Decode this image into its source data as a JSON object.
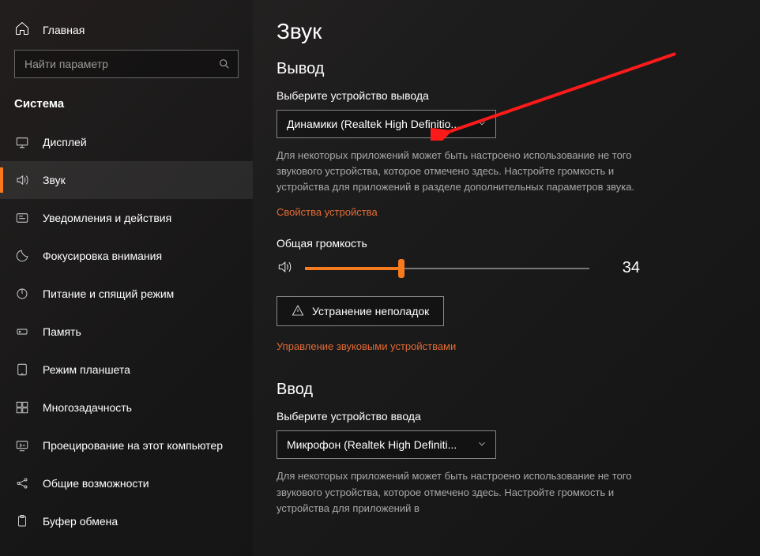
{
  "sidebar": {
    "home_label": "Главная",
    "search_placeholder": "Найти параметр",
    "section_title": "Система",
    "items": [
      {
        "label": "Дисплей",
        "icon": "display-icon"
      },
      {
        "label": "Звук",
        "icon": "sound-icon",
        "active": true
      },
      {
        "label": "Уведомления и действия",
        "icon": "notifications-icon"
      },
      {
        "label": "Фокусировка внимания",
        "icon": "focus-icon"
      },
      {
        "label": "Питание и спящий режим",
        "icon": "power-icon"
      },
      {
        "label": "Память",
        "icon": "storage-icon"
      },
      {
        "label": "Режим планшета",
        "icon": "tablet-icon"
      },
      {
        "label": "Многозадачность",
        "icon": "multitask-icon"
      },
      {
        "label": "Проецирование на этот компьютер",
        "icon": "projecting-icon"
      },
      {
        "label": "Общие возможности",
        "icon": "shared-icon"
      },
      {
        "label": "Буфер обмена",
        "icon": "clipboard-icon"
      }
    ]
  },
  "page": {
    "title": "Звук",
    "output": {
      "heading": "Вывод",
      "select_label": "Выберите устройство вывода",
      "selected_device": "Динамики (Realtek High Definitio...",
      "help_text": "Для некоторых приложений может быть настроено использование не того звукового устройства, которое отмечено здесь. Настройте громкость и устройства для приложений в разделе дополнительных параметров звука.",
      "device_props_link": "Свойства устройства",
      "volume_label": "Общая громкость",
      "volume_value": "34",
      "volume_percent": 34,
      "troubleshoot_button": "Устранение неполадок",
      "manage_link": "Управление звуковыми устройствами"
    },
    "input": {
      "heading": "Ввод",
      "select_label": "Выберите устройство ввода",
      "selected_device": "Микрофон (Realtek High Definiti...",
      "help_text": "Для некоторых приложений может быть настроено использование не того звукового устройства, которое отмечено здесь. Настройте громкость и устройства для приложений в"
    }
  }
}
